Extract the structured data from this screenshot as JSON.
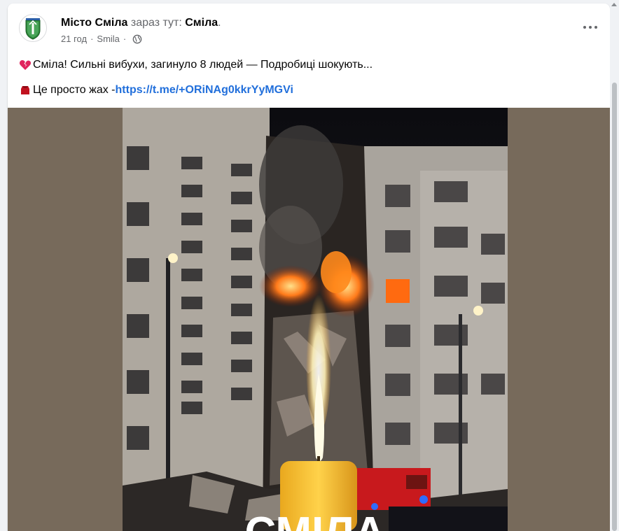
{
  "post": {
    "author_name": "Місто Сміла",
    "is_at_text": "зараз тут:",
    "location": "Сміла",
    "location_end": ".",
    "time": "21 год",
    "place": "Smila",
    "line1_text": "Сміла! Сильні вибухи, загинуло 8 людей — Подробиці шокують...",
    "line1_emoji": "broken-heart-icon",
    "line2_text": "Це просто жах - ",
    "line2_emoji": "red-envelope-icon",
    "link": "https://t.me/+ORiNAg0kkrYyMGVi",
    "audience_icon": "globe-icon",
    "more_icon": "more-horizontal-icon"
  },
  "media": {
    "overlay_text": "СМІЛА",
    "background_color": "#776a5b"
  }
}
